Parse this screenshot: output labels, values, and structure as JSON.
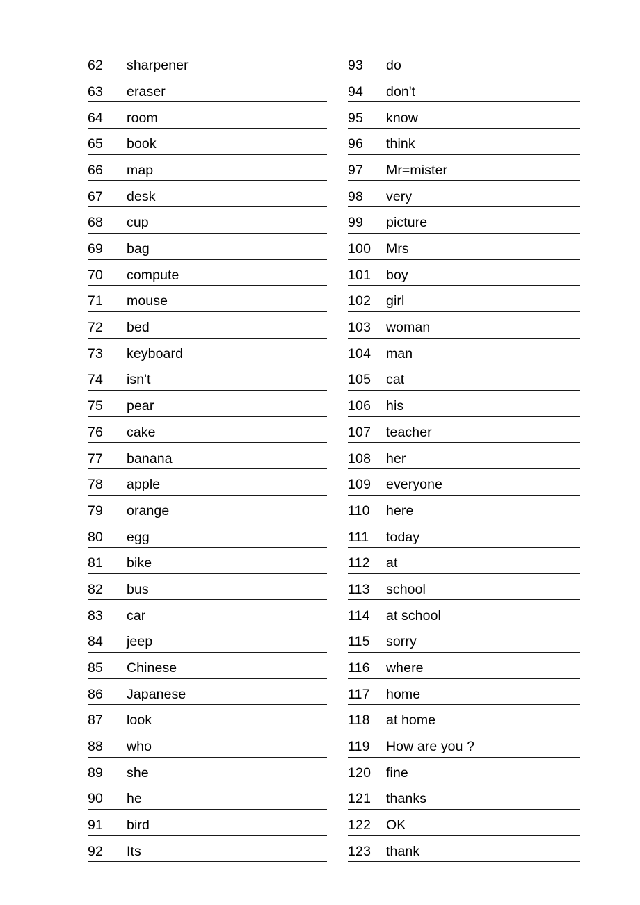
{
  "document": {
    "type": "vocabulary-word-list-worksheet",
    "background_color": "#ffffff",
    "text_color": "#000000",
    "rule_color": "#1a1a1a",
    "column_count": 2,
    "total_entries": 62,
    "number_range_start": 62,
    "number_range_end": 123
  },
  "columns": [
    {
      "name": "left-column",
      "entries": [
        {
          "number": "62",
          "word": "sharpener"
        },
        {
          "number": "63",
          "word": "eraser"
        },
        {
          "number": "64",
          "word": "room"
        },
        {
          "number": "65",
          "word": "book"
        },
        {
          "number": "66",
          "word": "map"
        },
        {
          "number": "67",
          "word": "desk"
        },
        {
          "number": "68",
          "word": "cup"
        },
        {
          "number": "69",
          "word": "bag"
        },
        {
          "number": "70",
          "word": "compute"
        },
        {
          "number": "71",
          "word": "mouse"
        },
        {
          "number": "72",
          "word": "bed"
        },
        {
          "number": "73",
          "word": "keyboard"
        },
        {
          "number": "74",
          "word": "isn't"
        },
        {
          "number": "75",
          "word": "pear"
        },
        {
          "number": "76",
          "word": "cake"
        },
        {
          "number": "77",
          "word": "banana"
        },
        {
          "number": "78",
          "word": "apple"
        },
        {
          "number": "79",
          "word": "orange"
        },
        {
          "number": "80",
          "word": "egg"
        },
        {
          "number": "81",
          "word": "bike"
        },
        {
          "number": "82",
          "word": "bus"
        },
        {
          "number": "83",
          "word": "car"
        },
        {
          "number": "84",
          "word": "jeep"
        },
        {
          "number": "85",
          "word": "Chinese"
        },
        {
          "number": "86",
          "word": "Japanese"
        },
        {
          "number": "87",
          "word": "look"
        },
        {
          "number": "88",
          "word": "who"
        },
        {
          "number": "89",
          "word": "she"
        },
        {
          "number": "90",
          "word": "he"
        },
        {
          "number": "91",
          "word": "bird"
        },
        {
          "number": "92",
          "word": "Its"
        }
      ]
    },
    {
      "name": "right-column",
      "entries": [
        {
          "number": "93",
          "word": "do"
        },
        {
          "number": "94",
          "word": "don't"
        },
        {
          "number": "95",
          "word": "know"
        },
        {
          "number": "96",
          "word": "think"
        },
        {
          "number": "97",
          "word": "Mr=mister"
        },
        {
          "number": "98",
          "word": "very"
        },
        {
          "number": "99",
          "word": "picture"
        },
        {
          "number": "100",
          "word": "Mrs"
        },
        {
          "number": "101",
          "word": "boy"
        },
        {
          "number": "102",
          "word": "girl"
        },
        {
          "number": "103",
          "word": "woman"
        },
        {
          "number": "104",
          "word": "man"
        },
        {
          "number": "105",
          "word": "cat"
        },
        {
          "number": "106",
          "word": "his"
        },
        {
          "number": "107",
          "word": "teacher"
        },
        {
          "number": "108",
          "word": "her"
        },
        {
          "number": "109",
          "word": "everyone"
        },
        {
          "number": "110",
          "word": "here"
        },
        {
          "number": "111",
          "word": "today"
        },
        {
          "number": "112",
          "word": "at"
        },
        {
          "number": "113",
          "word": "school"
        },
        {
          "number": "114",
          "word": "at school"
        },
        {
          "number": "115",
          "word": "sorry"
        },
        {
          "number": "116",
          "word": "where"
        },
        {
          "number": "117",
          "word": "home"
        },
        {
          "number": "118",
          "word": "at home"
        },
        {
          "number": "119",
          "word": "How are you ?"
        },
        {
          "number": "120",
          "word": "fine"
        },
        {
          "number": "121",
          "word": "thanks"
        },
        {
          "number": "122",
          "word": "OK"
        },
        {
          "number": "123",
          "word": "thank"
        }
      ]
    }
  ]
}
